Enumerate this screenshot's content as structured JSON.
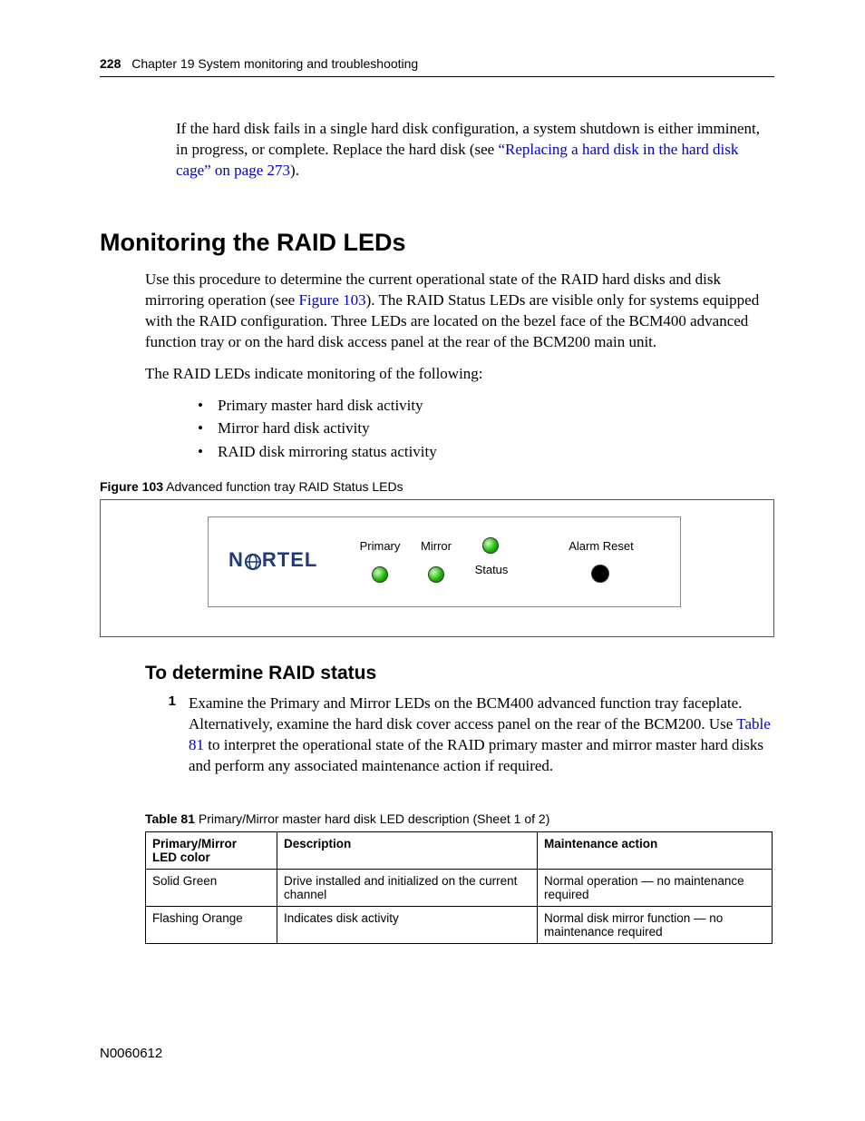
{
  "header": {
    "page_num": "228",
    "chapter": "Chapter 19  System monitoring and troubleshooting"
  },
  "intro_para": {
    "before": "If the hard disk fails in a single hard disk configuration, a system shutdown is either imminent, in progress, or complete. Replace the hard disk (see ",
    "link": "“Replacing a hard disk in the hard disk cage” on page 273",
    "after": ")."
  },
  "section_h1": "Monitoring the RAID LEDs",
  "para2": {
    "before": "Use this procedure to determine the current operational state of the RAID hard disks and disk mirroring operation (see ",
    "link": "Figure 103",
    "after": "). The RAID Status LEDs are visible only for systems equipped with the RAID configuration. Three LEDs are located on the bezel face of the BCM400 advanced function tray or on the hard disk access panel at the rear of the BCM200 main unit."
  },
  "para3": "The RAID LEDs indicate monitoring of the following:",
  "bullets": [
    "Primary master hard disk activity",
    "Mirror hard disk activity",
    "RAID disk mirroring status activity"
  ],
  "figure": {
    "caption_strong": "Figure 103",
    "caption_rest": "   Advanced function tray RAID Status LEDs",
    "logo_text_a": "N",
    "logo_text_b": "RTEL",
    "labels": {
      "primary": "Primary",
      "mirror": "Mirror",
      "status": "Status",
      "alarm": "Alarm Reset"
    }
  },
  "subsection_h2": "To determine RAID status",
  "step1": {
    "num": "1",
    "before": "Examine the Primary and Mirror LEDs on the BCM400 advanced function tray faceplate. Alternatively, examine the hard disk cover access panel on the rear of the BCM200. Use ",
    "link": "Table 81",
    "after": " to interpret the operational state of the RAID primary master and mirror master hard disks and perform any associated maintenance action if required."
  },
  "table": {
    "caption_strong": "Table 81",
    "caption_rest": "   Primary/Mirror master hard disk LED description (Sheet 1 of 2)",
    "headers": {
      "c1a": "Primary/Mirror",
      "c1b": "LED color",
      "c2": "Description",
      "c3": "Maintenance action"
    },
    "rows": [
      {
        "c1": "Solid Green",
        "c2": "Drive installed and initialized on the current channel",
        "c3": "Normal operation — no maintenance required"
      },
      {
        "c1": "Flashing Orange",
        "c2": "Indicates disk activity",
        "c3": "Normal disk mirror function — no maintenance required"
      }
    ]
  },
  "footer": "N0060612"
}
